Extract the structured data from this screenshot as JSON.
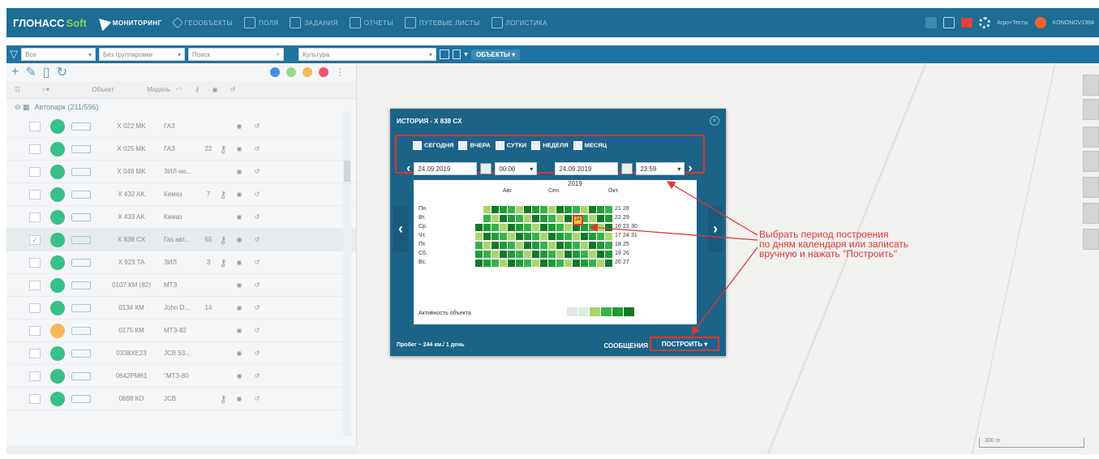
{
  "topbar": {
    "brand": "ГЛОНАСС",
    "brand_suffix": "Soft",
    "nav": [
      "МОНИТОРИНГ",
      "ГЕООБЪЕКТЫ",
      "ПОЛЯ",
      "ЗАДАНИЯ",
      "ОТЧЕТЫ",
      "ПУТЕВЫЕ ЛИСТЫ",
      "ЛОГИСТИКА"
    ],
    "company": "Агро+Тесты",
    "user": "KONONOV1984"
  },
  "toolbar": {
    "filter_all": "Все",
    "grouping": "Без группировки",
    "search_placeholder": "Поиск",
    "culture": "Культура",
    "objects_btn": "ОБЪЕКТЫ"
  },
  "table": {
    "col_object": "Объект",
    "col_model": "Модель",
    "group": "Автопарк (211/596)",
    "rows": [
      {
        "obj": "X 022 MK",
        "model": "ГАЗ",
        "n": "",
        "key": false,
        "status": "#37c08b",
        "checked": false
      },
      {
        "obj": "X 025 MK",
        "model": "ГАЗ",
        "n": "22",
        "key": true,
        "status": "#37c08b",
        "checked": false
      },
      {
        "obj": "X 049 MK",
        "model": "ЗИЛ-но...",
        "n": "",
        "key": false,
        "status": "#37c08b",
        "checked": false
      },
      {
        "obj": "X 432 AK",
        "model": "Камаз",
        "n": "7",
        "key": true,
        "status": "#37c08b",
        "checked": false
      },
      {
        "obj": "X 433 AK",
        "model": "Камаз",
        "n": "",
        "key": false,
        "status": "#37c08b",
        "checked": false
      },
      {
        "obj": "X 838 CX",
        "model": "Газ авт...",
        "n": "55",
        "key": true,
        "status": "#37c08b",
        "checked": true
      },
      {
        "obj": "X 923 TA",
        "model": "ЗИЛ",
        "n": "3",
        "key": true,
        "status": "#37c08b",
        "checked": false
      },
      {
        "obj": "0107 КМ (82)",
        "model": "МТЗ",
        "n": "",
        "key": false,
        "status": "#37c08b",
        "checked": false
      },
      {
        "obj": "0134 КМ",
        "model": "John D...",
        "n": "14",
        "key": false,
        "status": "#37c08b",
        "checked": false
      },
      {
        "obj": "0175 КМ",
        "model": "МТЗ-82",
        "n": "",
        "key": false,
        "status": "#f7b955",
        "checked": false
      },
      {
        "obj": "0338ХЕ23",
        "model": "JCB 53...",
        "n": "",
        "key": false,
        "status": "#37c08b",
        "checked": false
      },
      {
        "obj": "0642РМ61",
        "model": "\"МТЗ-80",
        "n": "",
        "key": false,
        "status": "#37c08b",
        "checked": false
      },
      {
        "obj": "0698 КО",
        "model": "JCB",
        "n": "",
        "key": true,
        "status": "#37c08b",
        "checked": false
      }
    ]
  },
  "dialog": {
    "title": "ИСТОРИЯ - X 838 CX",
    "quick": [
      "СЕГОДНЯ",
      "ВЧЕРА",
      "СУТКИ",
      "НЕДЕЛЯ",
      "МЕСЯЦ"
    ],
    "date_from": "24.09.2019",
    "time_from": "00:00",
    "date_to": "24.09.2019",
    "time_to": "23:59",
    "year": "2019",
    "months": [
      "Авг.",
      "Сен.",
      "Окт."
    ],
    "days": [
      "Пн.",
      "Вт.",
      "Ср.",
      "Чт.",
      "Пт.",
      "Сб.",
      "Вс."
    ],
    "activity_label": "Активность объекта",
    "mileage": "Пробег ~ 244 км./ 1 день",
    "messages_btn": "СООБЩЕНИЯ",
    "build_btn": "ПОСТРОИТЬ",
    "oct_days": [
      [
        "21",
        "28"
      ],
      [
        "22",
        "29"
      ],
      [
        "16",
        "23",
        "30"
      ],
      [
        "17",
        "24",
        "31"
      ],
      [
        "18",
        "25"
      ],
      [
        "19",
        "26"
      ],
      [
        "20",
        "27"
      ]
    ],
    "selected_day": "24"
  },
  "annotation": {
    "lines": [
      "Выбрать период построения",
      "по дням календаря или записать",
      "вручную и нажать \"Построить\""
    ]
  },
  "map": {
    "scale": "300 m"
  },
  "colors": {
    "accent": "#1d6d94",
    "dialog": "#1c6388",
    "highlight": "#e0362c",
    "legend": [
      "#e6e6e6",
      "#d9f0e8",
      "#a9d66b",
      "#35b24a",
      "#1f9c35",
      "#0e7a27"
    ]
  }
}
